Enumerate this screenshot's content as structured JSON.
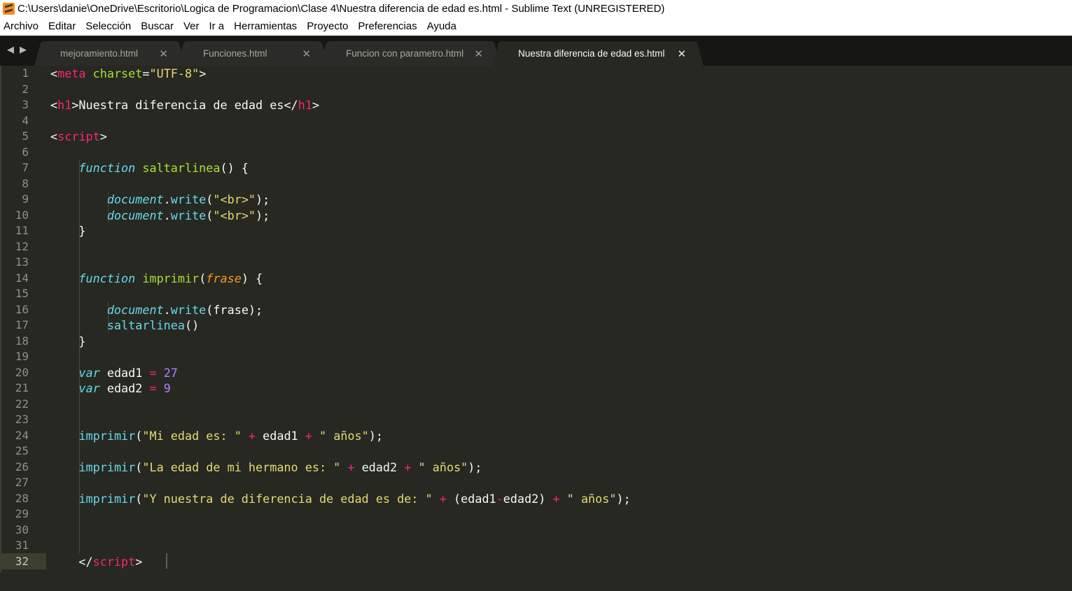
{
  "window": {
    "title": "C:\\Users\\danie\\OneDrive\\Escritorio\\Logica de Programacion\\Clase 4\\Nuestra diferencia de edad es.html - Sublime Text (UNREGISTERED)",
    "icon": "sublime-text-icon"
  },
  "menu": [
    "Archivo",
    "Editar",
    "Selección",
    "Buscar",
    "Ver",
    "Ir a",
    "Herramientas",
    "Proyecto",
    "Preferencias",
    "Ayuda"
  ],
  "tabs": [
    {
      "label": "mejoramiento.html",
      "active": false
    },
    {
      "label": "Funciones.html",
      "active": false
    },
    {
      "label": "Funcion con parametro.html",
      "active": false
    },
    {
      "label": "Nuestra diferencia de edad es.html",
      "active": true
    }
  ],
  "nav": {
    "back": "◀",
    "forward": "▶"
  },
  "tab_close_glyph": "✕",
  "editor": {
    "current_line": 32,
    "colors": {
      "background": "#272822",
      "tag": "#f92672",
      "attribute": "#a6e22e",
      "string": "#e6db74",
      "keyword": "#66d9ef",
      "number": "#ae81ff",
      "parameter": "#fd971f"
    },
    "lines": [
      {
        "n": "1",
        "tokens": [
          [
            "plain",
            "<"
          ],
          [
            "tag",
            "meta"
          ],
          [
            "plain",
            " "
          ],
          [
            "attr",
            "charset"
          ],
          [
            "plain",
            "="
          ],
          [
            "str",
            "\"UTF-8\""
          ],
          [
            "plain",
            ">"
          ]
        ]
      },
      {
        "n": "2",
        "tokens": []
      },
      {
        "n": "3",
        "tokens": [
          [
            "plain",
            "<"
          ],
          [
            "tag",
            "h1"
          ],
          [
            "plain",
            ">Nuestra diferencia de edad es</"
          ],
          [
            "tag",
            "h1"
          ],
          [
            "plain",
            ">"
          ]
        ]
      },
      {
        "n": "4",
        "tokens": []
      },
      {
        "n": "5",
        "tokens": [
          [
            "plain",
            "<"
          ],
          [
            "tag",
            "script"
          ],
          [
            "plain",
            ">"
          ]
        ]
      },
      {
        "n": "6",
        "tokens": []
      },
      {
        "n": "7",
        "tokens": [
          [
            "plain",
            "    "
          ],
          [
            "kw",
            "function"
          ],
          [
            "plain",
            " "
          ],
          [
            "fn",
            "saltarlinea"
          ],
          [
            "plain",
            "() {"
          ]
        ]
      },
      {
        "n": "8",
        "tokens": []
      },
      {
        "n": "9",
        "tokens": [
          [
            "plain",
            "        "
          ],
          [
            "kw",
            "document"
          ],
          [
            "plain",
            "."
          ],
          [
            "call",
            "write"
          ],
          [
            "plain",
            "("
          ],
          [
            "str",
            "\"<br>\""
          ],
          [
            "plain",
            ");"
          ]
        ]
      },
      {
        "n": "10",
        "tokens": [
          [
            "plain",
            "        "
          ],
          [
            "kw",
            "document"
          ],
          [
            "plain",
            "."
          ],
          [
            "call",
            "write"
          ],
          [
            "plain",
            "("
          ],
          [
            "str",
            "\"<br>\""
          ],
          [
            "plain",
            ");"
          ]
        ]
      },
      {
        "n": "11",
        "tokens": [
          [
            "plain",
            "    }"
          ]
        ]
      },
      {
        "n": "12",
        "tokens": []
      },
      {
        "n": "13",
        "tokens": []
      },
      {
        "n": "14",
        "tokens": [
          [
            "plain",
            "    "
          ],
          [
            "kw",
            "function"
          ],
          [
            "plain",
            " "
          ],
          [
            "fn",
            "imprimir"
          ],
          [
            "plain",
            "("
          ],
          [
            "param",
            "frase"
          ],
          [
            "plain",
            ") {"
          ]
        ]
      },
      {
        "n": "15",
        "tokens": []
      },
      {
        "n": "16",
        "tokens": [
          [
            "plain",
            "        "
          ],
          [
            "kw",
            "document"
          ],
          [
            "plain",
            "."
          ],
          [
            "call",
            "write"
          ],
          [
            "plain",
            "(frase);"
          ]
        ]
      },
      {
        "n": "17",
        "tokens": [
          [
            "plain",
            "        "
          ],
          [
            "call",
            "saltarlinea"
          ],
          [
            "plain",
            "()"
          ]
        ]
      },
      {
        "n": "18",
        "tokens": [
          [
            "plain",
            "    }"
          ]
        ]
      },
      {
        "n": "19",
        "tokens": []
      },
      {
        "n": "20",
        "tokens": [
          [
            "plain",
            "    "
          ],
          [
            "kw",
            "var"
          ],
          [
            "plain",
            " edad1 "
          ],
          [
            "op",
            "="
          ],
          [
            "plain",
            " "
          ],
          [
            "num",
            "27"
          ]
        ]
      },
      {
        "n": "21",
        "tokens": [
          [
            "plain",
            "    "
          ],
          [
            "kw",
            "var"
          ],
          [
            "plain",
            " edad2 "
          ],
          [
            "op",
            "="
          ],
          [
            "plain",
            " "
          ],
          [
            "num",
            "9"
          ]
        ]
      },
      {
        "n": "22",
        "tokens": []
      },
      {
        "n": "23",
        "tokens": []
      },
      {
        "n": "24",
        "tokens": [
          [
            "plain",
            "    "
          ],
          [
            "call",
            "imprimir"
          ],
          [
            "plain",
            "("
          ],
          [
            "str",
            "\"Mi edad es: \""
          ],
          [
            "plain",
            " "
          ],
          [
            "op",
            "+"
          ],
          [
            "plain",
            " edad1 "
          ],
          [
            "op",
            "+"
          ],
          [
            "plain",
            " "
          ],
          [
            "str",
            "\" años\""
          ],
          [
            "plain",
            ");"
          ]
        ]
      },
      {
        "n": "25",
        "tokens": []
      },
      {
        "n": "26",
        "tokens": [
          [
            "plain",
            "    "
          ],
          [
            "call",
            "imprimir"
          ],
          [
            "plain",
            "("
          ],
          [
            "str",
            "\"La edad de mi hermano es: \""
          ],
          [
            "plain",
            " "
          ],
          [
            "op",
            "+"
          ],
          [
            "plain",
            " edad2 "
          ],
          [
            "op",
            "+"
          ],
          [
            "plain",
            " "
          ],
          [
            "str",
            "\" años\""
          ],
          [
            "plain",
            ");"
          ]
        ]
      },
      {
        "n": "27",
        "tokens": []
      },
      {
        "n": "28",
        "tokens": [
          [
            "plain",
            "    "
          ],
          [
            "call",
            "imprimir"
          ],
          [
            "plain",
            "("
          ],
          [
            "str",
            "\"Y nuestra de diferencia de edad es de: \""
          ],
          [
            "plain",
            " "
          ],
          [
            "op",
            "+"
          ],
          [
            "plain",
            " (edad1"
          ],
          [
            "op",
            "-"
          ],
          [
            "plain",
            "edad2) "
          ],
          [
            "op",
            "+"
          ],
          [
            "plain",
            " "
          ],
          [
            "str",
            "\" años\""
          ],
          [
            "plain",
            ");"
          ]
        ]
      },
      {
        "n": "29",
        "tokens": []
      },
      {
        "n": "30",
        "tokens": []
      },
      {
        "n": "31",
        "tokens": []
      },
      {
        "n": "32",
        "tokens": [
          [
            "plain",
            "    </"
          ],
          [
            "tag",
            "script"
          ],
          [
            "plain",
            ">"
          ]
        ]
      }
    ]
  }
}
